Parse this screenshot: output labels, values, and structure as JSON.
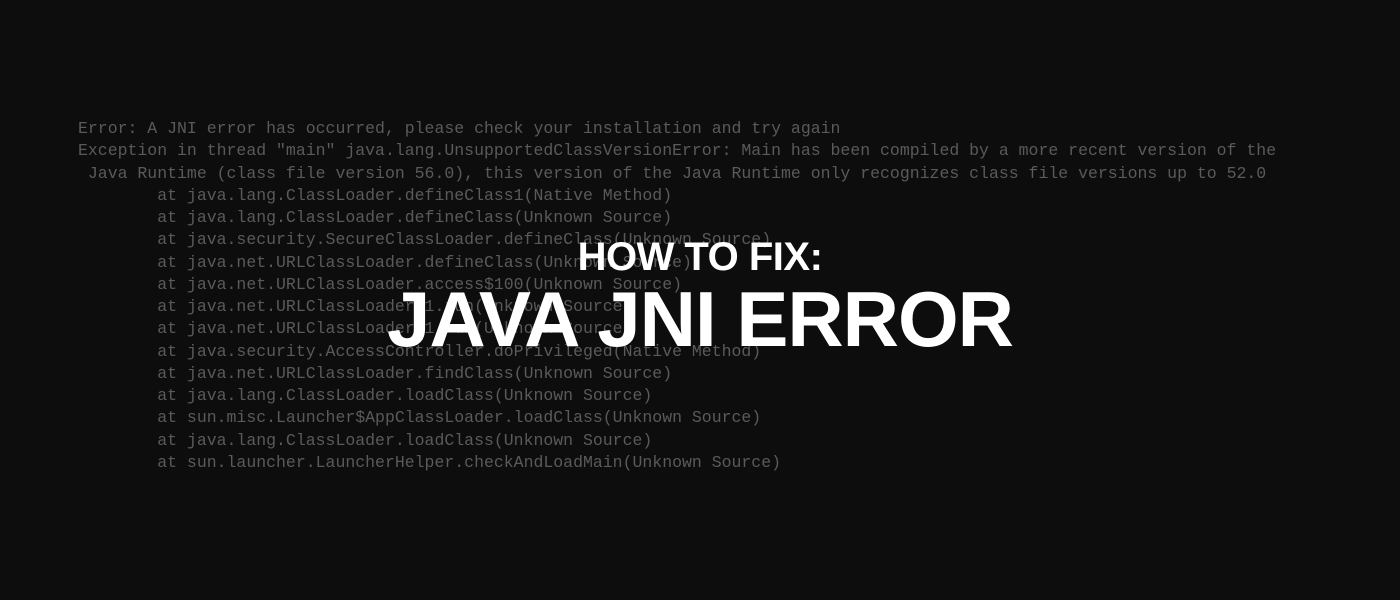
{
  "terminal": {
    "line1": "Error: A JNI error has occurred, please check your installation and try again",
    "line2": "Exception in thread \"main\" java.lang.UnsupportedClassVersionError: Main has been compiled by a more recent version of the",
    "line3": " Java Runtime (class file version 56.0), this version of the Java Runtime only recognizes class file versions up to 52.0",
    "stack1": "        at java.lang.ClassLoader.defineClass1(Native Method)",
    "stack2": "        at java.lang.ClassLoader.defineClass(Unknown Source)",
    "stack3": "        at java.security.SecureClassLoader.defineClass(Unknown Source)",
    "stack4": "        at java.net.URLClassLoader.defineClass(Unknown Source)",
    "stack5": "        at java.net.URLClassLoader.access$100(Unknown Source)",
    "stack6": "        at java.net.URLClassLoader$1.run(Unknown Source)",
    "stack7": "        at java.net.URLClassLoader$1.run(Unknown Source)",
    "stack8": "        at java.security.AccessController.doPrivileged(Native Method)",
    "stack9": "        at java.net.URLClassLoader.findClass(Unknown Source)",
    "stack10": "        at java.lang.ClassLoader.loadClass(Unknown Source)",
    "stack11": "        at sun.misc.Launcher$AppClassLoader.loadClass(Unknown Source)",
    "stack12": "        at java.lang.ClassLoader.loadClass(Unknown Source)",
    "stack13": "        at sun.launcher.LauncherHelper.checkAndLoadMain(Unknown Source)"
  },
  "overlay": {
    "line1": "HOW TO FIX:",
    "line2": "JAVA JNI ERROR"
  }
}
